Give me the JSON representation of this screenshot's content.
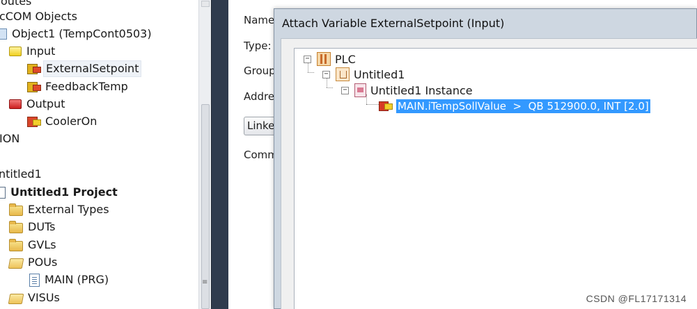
{
  "left_tree": {
    "items": [
      {
        "label": "outes",
        "icon": "none"
      },
      {
        "label": "cCOM Objects",
        "icon": "none"
      },
      {
        "label": "Object1 (TempCont0503)",
        "icon": "object-icon"
      },
      {
        "label": "Input",
        "icon": "input-folder-icon"
      },
      {
        "label": "ExternalSetpoint",
        "icon": "input-variable-icon"
      },
      {
        "label": "FeedbackTemp",
        "icon": "input-variable-icon"
      },
      {
        "label": "Output",
        "icon": "output-folder-icon"
      },
      {
        "label": "CoolerOn",
        "icon": "output-variable-icon"
      },
      {
        "label": "ION",
        "icon": "none"
      },
      {
        "label": "ntitled1",
        "icon": "none"
      },
      {
        "label": "Untitled1 Project",
        "icon": "project-icon"
      },
      {
        "label": "External Types",
        "icon": "folder-icon"
      },
      {
        "label": "DUTs",
        "icon": "folder-icon"
      },
      {
        "label": "GVLs",
        "icon": "folder-icon"
      },
      {
        "label": "POUs",
        "icon": "open-folder-icon"
      },
      {
        "label": "MAIN (PRG)",
        "icon": "document-icon"
      },
      {
        "label": "VISUs",
        "icon": "open-folder-icon"
      }
    ]
  },
  "properties": {
    "name_label": "Name:",
    "type_label": "Type:",
    "group_label": "Group:",
    "address_label": "Addres",
    "linked_label": "Linked",
    "comment_label": "Comme"
  },
  "dialog": {
    "title": "Attach Variable ExternalSetpoint (Input)",
    "tree": {
      "root": {
        "label": "PLC",
        "expander": "⊟"
      },
      "project": {
        "label": "Untitled1",
        "expander": "⊟"
      },
      "instance": {
        "label": "Untitled1 Instance",
        "expander": "⊟"
      },
      "variable": {
        "name": "MAIN.iTempSollValue",
        "separator": "  >  ",
        "address": "QB 512900.0, INT [2.0]"
      }
    }
  },
  "watermark": "CSDN @FL17171314",
  "colors": {
    "selection": "#3399ff",
    "splitter": "#2f3b4d",
    "dialog_frame": "#ced7e1"
  }
}
